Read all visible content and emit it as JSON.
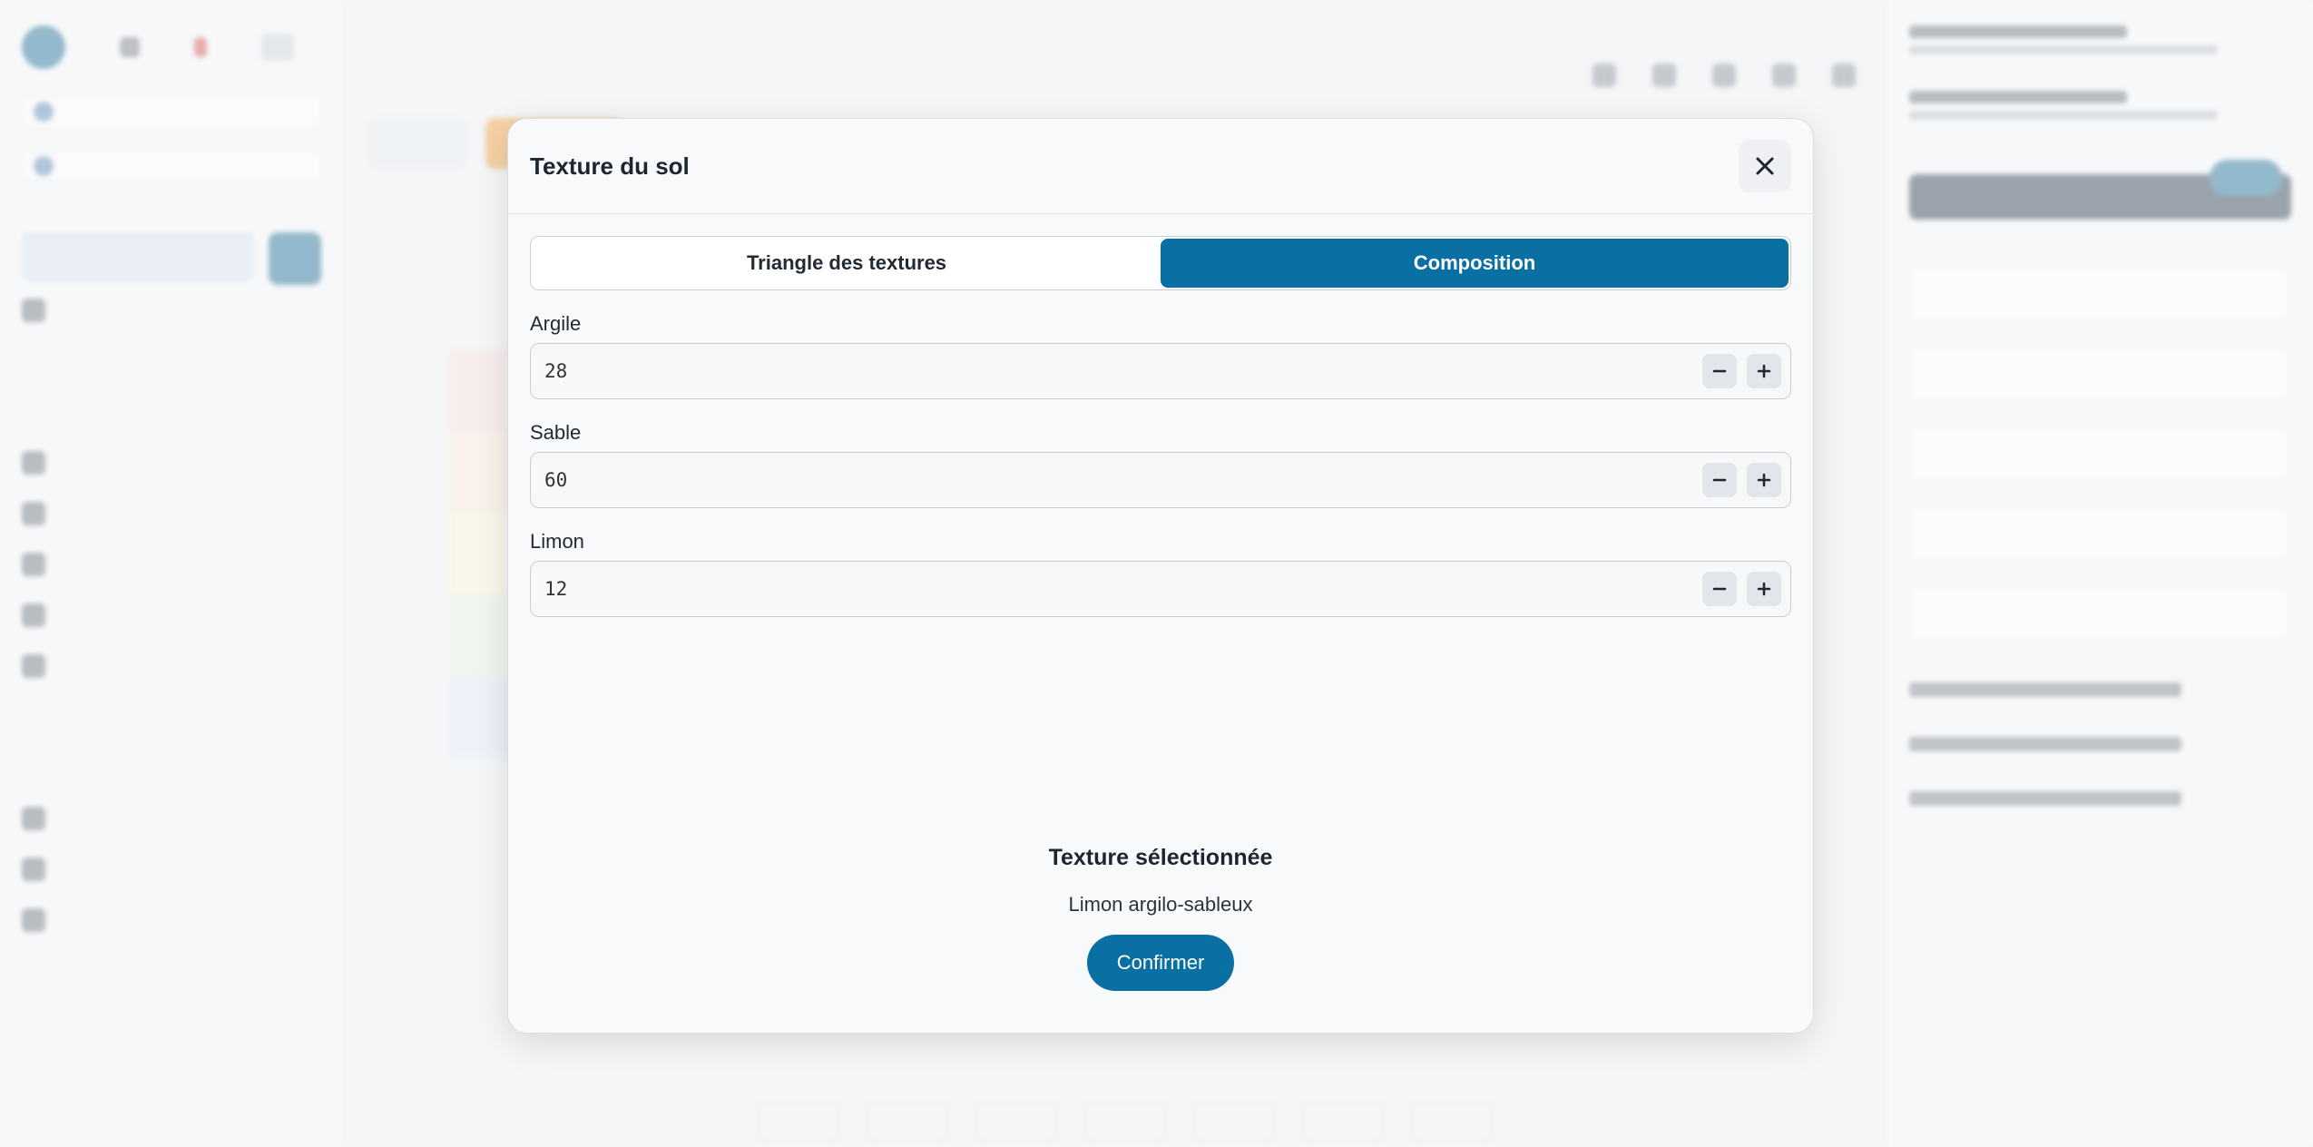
{
  "modal": {
    "title": "Texture du sol",
    "tabs": [
      {
        "label": "Triangle des textures",
        "active": false
      },
      {
        "label": "Composition",
        "active": true
      }
    ],
    "fields": [
      {
        "label": "Argile",
        "value": "28"
      },
      {
        "label": "Sable",
        "value": "60"
      },
      {
        "label": "Limon",
        "value": "12"
      }
    ],
    "selected_title": "Texture sélectionnée",
    "selected_value": "Limon argilo-sableux",
    "confirm_label": "Confirmer"
  },
  "colors": {
    "accent": "#0a6fa3",
    "modal_bg": "#f8f9fb",
    "stepper_bg": "#e2e5e9"
  },
  "icons": {
    "close": "close-icon",
    "minus": "minus-icon",
    "plus": "plus-icon"
  }
}
